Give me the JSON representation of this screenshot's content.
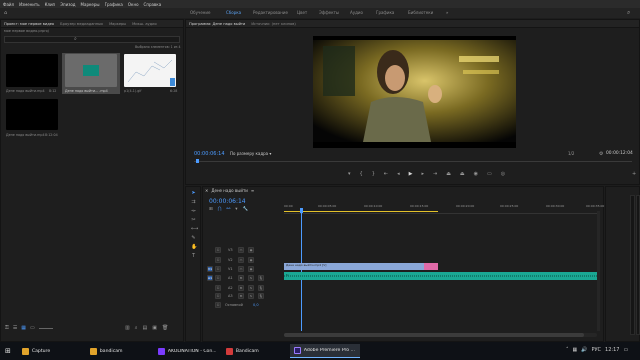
{
  "menu": [
    "Файл",
    "Изменить",
    "Клип",
    "Эпизод",
    "Маркеры",
    "Графика",
    "Окно",
    "Справка"
  ],
  "workspaces": [
    {
      "label": "Обучение",
      "active": false
    },
    {
      "label": "Сборка",
      "active": true
    },
    {
      "label": "Редактирование",
      "active": false
    },
    {
      "label": "Цвет",
      "active": false
    },
    {
      "label": "Эффекты",
      "active": false
    },
    {
      "label": "Аудио",
      "active": false
    },
    {
      "label": "Графика",
      "active": false
    },
    {
      "label": "Библиотеки",
      "active": false
    }
  ],
  "project_panel": {
    "tabs": [
      "Проект: мое первое видео",
      "Браузер медиаданных",
      "Маркеры",
      "Микш. аудио"
    ],
    "path": "мое первое видео.prproj",
    "selected_count": "Выбрано элементов: 1 из 4",
    "items": [
      {
        "name": "Дене надо выйти.mp4",
        "duration": "8:12"
      },
      {
        "name": "Дене надо выйти... .mp4",
        "duration": "8:12"
      },
      {
        "name": "p1(4-1).gif",
        "duration": "6:28"
      },
      {
        "name": "Дене надо выйти.mp4",
        "duration": "8:12:04"
      }
    ]
  },
  "source_panel": {
    "tabs": [
      "Программа: Дене надо выйти",
      "Источник: (нет клипов)"
    ],
    "timecode": "00:00:06:14",
    "fit": "По размеру кадра",
    "fraction": "1/2",
    "duration": "00:00:12:04"
  },
  "timeline": {
    "tab": "Дене надо выйти",
    "timecode": "00:00:06:14",
    "ruler_labels": [
      "00:00",
      "00:00:05:00",
      "00:00:10:00",
      "00:00:15:00",
      "00:00:20:00",
      "00:00:25:00",
      "00:00:30:00",
      "00:00:35:00"
    ],
    "video_tracks": [
      "V3",
      "V2",
      "V1"
    ],
    "audio_tracks": [
      "A1",
      "A2",
      "A3"
    ],
    "master": "Основной",
    "master_value": "0,0",
    "video_clip": "Дене надо выйти.mp4 [V]",
    "audio_clip": "fx"
  },
  "taskbar": {
    "items": [
      {
        "label": "Capture",
        "color": "#e2a42b",
        "active": false
      },
      {
        "label": "bandicam",
        "color": "#e2a42b",
        "active": false
      },
      {
        "label": "AKOLINATION - Con...",
        "color": "#7a3bff",
        "active": false
      },
      {
        "label": "Bandicam",
        "color": "#d33b3b",
        "active": false
      },
      {
        "label": "Adobe Premiere Pro ...",
        "color": "#2a1e66",
        "active": true
      }
    ],
    "lang": "РУС",
    "time": "12:17"
  }
}
